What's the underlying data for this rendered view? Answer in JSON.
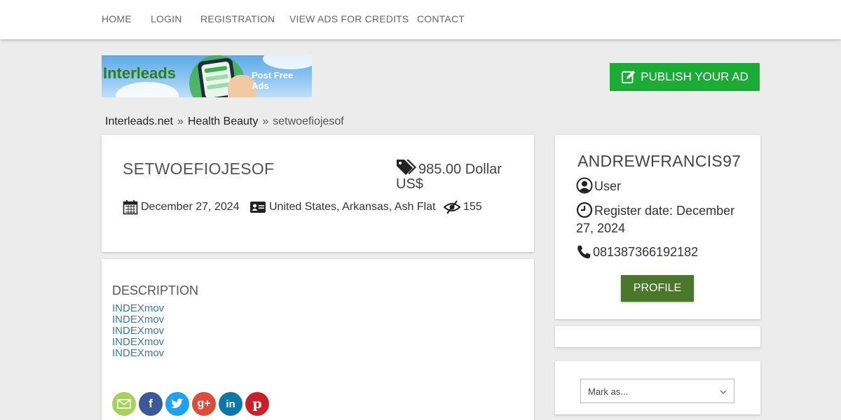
{
  "nav": {
    "items": [
      "HOME",
      "LOGIN",
      "REGISTRATION",
      "VIEW ADS FOR CREDITS",
      "CONTACT"
    ]
  },
  "banner": {
    "brand": "Interleads",
    "tagline": "Post Free Ads"
  },
  "publish_button": "PUBLISH YOUR AD",
  "breadcrumb": {
    "root": "Interleads.net",
    "category": "Health Beauty",
    "current": "setwoefiojesof",
    "separator": "»"
  },
  "ad": {
    "title": "SETWOEFIOJESOF",
    "price": "985.00 Dollar US$",
    "date": "December 27, 2024",
    "location": "United States, Arkansas, Ash Flat",
    "views": "155"
  },
  "description": {
    "heading": "DESCRIPTION",
    "links": [
      "INDEXmov",
      "INDEXmov",
      "INDEXmov",
      "INDEXmov",
      "INDEXmov"
    ]
  },
  "share_icons": [
    "email-icon",
    "facebook-icon",
    "twitter-icon",
    "google-plus-icon",
    "linkedin-icon",
    "pinterest-icon"
  ],
  "user": {
    "name": "ANDREWFRANCIS97",
    "role": "User",
    "register_date": "Register date: December 27, 2024",
    "phone": "081387366192182",
    "profile_button": "PROFILE"
  },
  "mark_as": {
    "placeholder": "Mark as..."
  },
  "colors": {
    "publish": "#1aac35",
    "profile": "#4b772b",
    "link": "#337ab7"
  }
}
